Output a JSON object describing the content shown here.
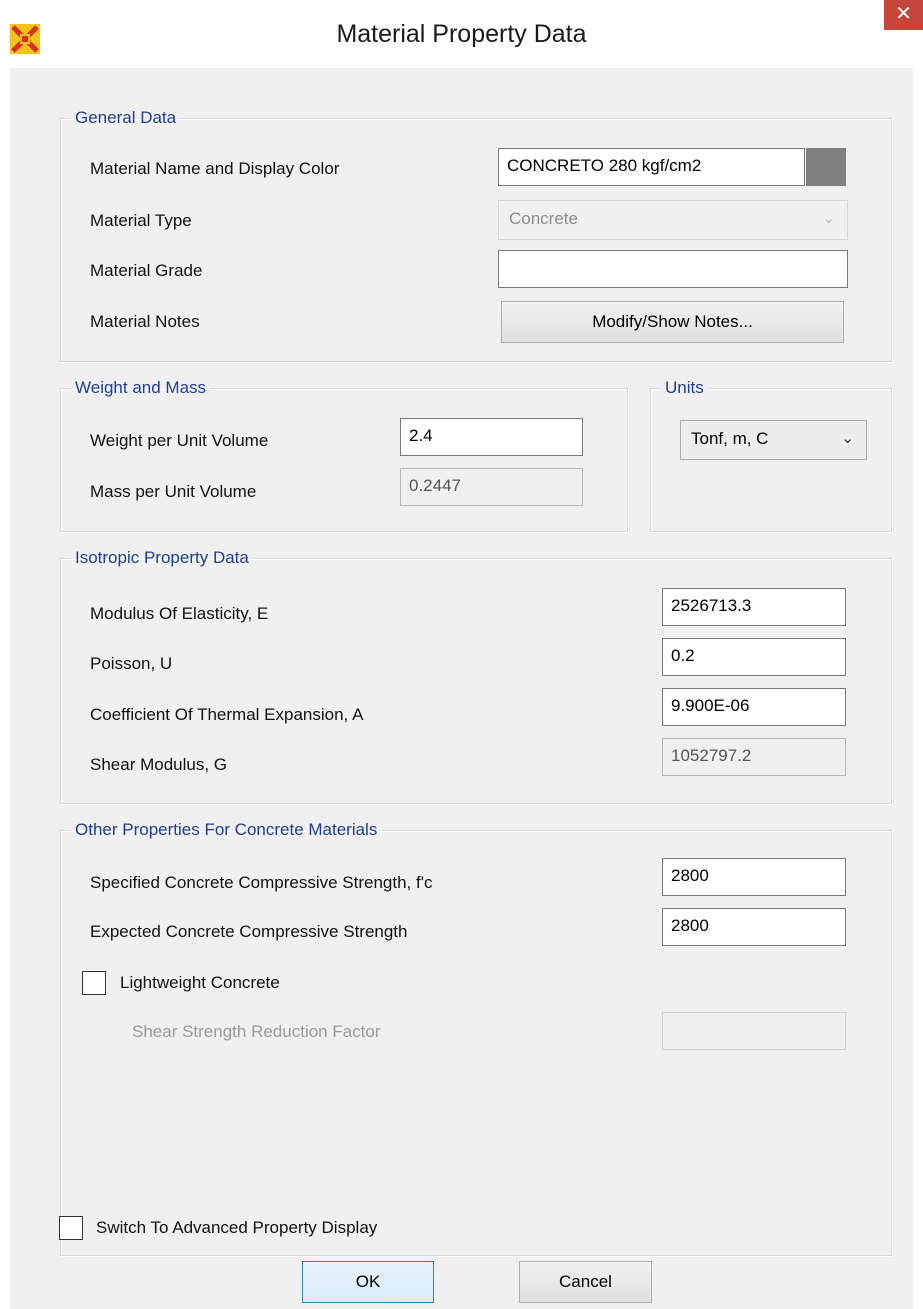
{
  "window": {
    "title": "Material Property Data",
    "close_glyph": "✕",
    "app_icon": "etabs-app-icon"
  },
  "general": {
    "legend": "General Data",
    "name_label": "Material Name and Display Color",
    "name_value": "CONCRETO 280 kgf/cm2",
    "display_color": "#808080",
    "type_label": "Material Type",
    "type_value": "Concrete",
    "grade_label": "Material Grade",
    "grade_value": "",
    "notes_label": "Material Notes",
    "notes_button": "Modify/Show Notes..."
  },
  "weight": {
    "legend": "Weight and Mass",
    "weight_label": "Weight per Unit Volume",
    "weight_value": "2.4",
    "mass_label": "Mass per Unit Volume",
    "mass_value": "0.2447"
  },
  "units": {
    "legend": "Units",
    "value": "Tonf, m, C"
  },
  "isotropic": {
    "legend": "Isotropic Property Data",
    "e_label": "Modulus Of Elasticity,  E",
    "e_value": "2526713.3",
    "u_label": "Poisson,  U",
    "u_value": "0.2",
    "a_label": "Coefficient Of Thermal Expansion,  A",
    "a_value": "9.900E-06",
    "g_label": "Shear Modulus,  G",
    "g_value": "1052797.2"
  },
  "concrete": {
    "legend": "Other Properties For Concrete Materials",
    "fc_label": "Specified Concrete Compressive Strength, f'c",
    "fc_value": "2800",
    "expected_label": "Expected Concrete Compressive Strength",
    "expected_value": "2800",
    "lightweight_label": "Lightweight Concrete",
    "lightweight_checked": false,
    "reduction_label": "Shear Strength Reduction Factor",
    "reduction_value": ""
  },
  "advanced_label": "Switch To Advanced Property Display",
  "advanced_checked": false,
  "buttons": {
    "ok": "OK",
    "cancel": "Cancel"
  }
}
